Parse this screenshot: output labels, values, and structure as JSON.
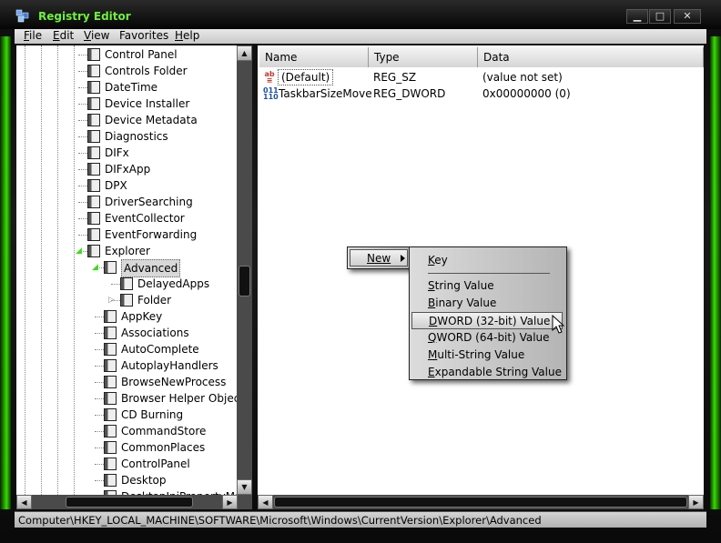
{
  "window": {
    "title": "Registry Editor"
  },
  "menubar": [
    {
      "label": "File",
      "underline": "F",
      "rest": "ile"
    },
    {
      "label": "Edit",
      "underline": "E",
      "rest": "dit"
    },
    {
      "label": "View",
      "underline": "V",
      "rest": "iew"
    },
    {
      "label": "Favorites",
      "underline": "",
      "rest": "Favorites"
    },
    {
      "label": "Help",
      "underline": "H",
      "rest": "elp"
    }
  ],
  "tree": {
    "items": [
      {
        "label": "Control Panel",
        "level": 1
      },
      {
        "label": "Controls Folder",
        "level": 1
      },
      {
        "label": "DateTime",
        "level": 1
      },
      {
        "label": "Device Installer",
        "level": 1
      },
      {
        "label": "Device Metadata",
        "level": 1
      },
      {
        "label": "Diagnostics",
        "level": 1
      },
      {
        "label": "DIFx",
        "level": 1
      },
      {
        "label": "DIFxApp",
        "level": 1
      },
      {
        "label": "DPX",
        "level": 1
      },
      {
        "label": "DriverSearching",
        "level": 1
      },
      {
        "label": "EventCollector",
        "level": 1
      },
      {
        "label": "EventForwarding",
        "level": 1
      },
      {
        "label": "Explorer",
        "level": 1
      },
      {
        "label": "Advanced",
        "level": 2
      },
      {
        "label": "DelayedApps",
        "level": 3
      },
      {
        "label": "Folder",
        "level": 3
      },
      {
        "label": "AppKey",
        "level": 2
      },
      {
        "label": "Associations",
        "level": 2
      },
      {
        "label": "AutoComplete",
        "level": 2
      },
      {
        "label": "AutoplayHandlers",
        "level": 2
      },
      {
        "label": "BrowseNewProcess",
        "level": 2
      },
      {
        "label": "Browser Helper Objects",
        "level": 2
      },
      {
        "label": "CD Burning",
        "level": 2
      },
      {
        "label": "CommandStore",
        "level": 2
      },
      {
        "label": "CommonPlaces",
        "level": 2
      },
      {
        "label": "ControlPanel",
        "level": 2
      },
      {
        "label": "Desktop",
        "level": 2
      },
      {
        "label": "DesktopIniPropertyMap",
        "level": 2
      }
    ]
  },
  "list": {
    "columns": [
      "Name",
      "Type",
      "Data"
    ],
    "rows": [
      {
        "name": "(Default)",
        "type": "REG_SZ",
        "data": "(value not set)",
        "icon": "string-value-icon"
      },
      {
        "name": "TaskbarSizeMove",
        "type": "REG_DWORD",
        "data": "0x00000000 (0)",
        "icon": "binary-value-icon"
      }
    ]
  },
  "context_menu": {
    "new_label": "New"
  },
  "new_submenu": {
    "items": [
      {
        "label": "Key",
        "u": "K",
        "rest": "ey"
      },
      {
        "label": "String Value",
        "u": "S",
        "rest": "tring Value"
      },
      {
        "label": "Binary Value",
        "u": "B",
        "rest": "inary Value"
      },
      {
        "label": "DWORD (32-bit) Value",
        "u": "D",
        "rest": "WORD (32-bit) Value",
        "highlighted": true
      },
      {
        "label": "QWORD (64-bit) Value",
        "u": "Q",
        "rest": "WORD (64-bit) Value"
      },
      {
        "label": "Multi-String Value",
        "u": "M",
        "rest": "ulti-String Value"
      },
      {
        "label": "Expandable String Value",
        "u": "E",
        "rest": "xpandable String Value"
      }
    ]
  },
  "statusbar": {
    "path": "Computer\\HKEY_LOCAL_MACHINE\\SOFTWARE\\Microsoft\\Windows\\CurrentVersion\\Explorer\\Advanced"
  },
  "colors": {
    "title": "#6df23a",
    "glow": "#3cff00"
  }
}
